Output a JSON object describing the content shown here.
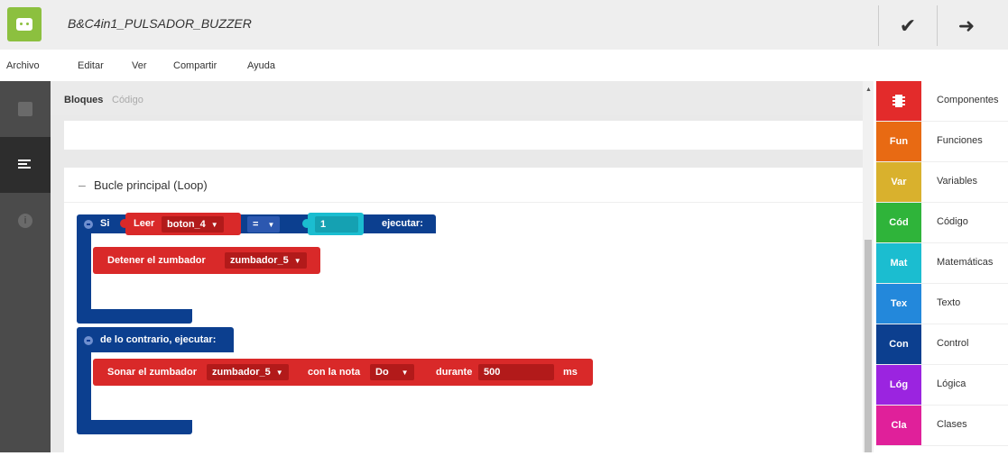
{
  "header": {
    "title": "B&C4in1_PULSADOR_BUZZER"
  },
  "menu": [
    "Archivo",
    "Editar",
    "Ver",
    "Compartir",
    "Ayuda"
  ],
  "tabs": {
    "bloques": "Bloques",
    "codigo": "Código"
  },
  "loop": {
    "title": "Bucle principal (Loop)"
  },
  "blocks": {
    "si": "Si",
    "leer": "Leer",
    "boton": "boton_4",
    "op": "=",
    "value": "1",
    "ejecutar": "ejecutar:",
    "detener": "Detener el zumbador",
    "zumbador1": "zumbador_5",
    "else_label": "de lo contrario, ejecutar:",
    "sonar": "Sonar el zumbador",
    "zumbador2": "zumbador_5",
    "nota_label": "con la nota",
    "nota": "Do",
    "durante": "durante",
    "duration": "500",
    "ms": "ms"
  },
  "categories": [
    {
      "abbr": "",
      "label": "Componentes",
      "color": "#e32b2b"
    },
    {
      "abbr": "Fun",
      "label": "Funciones",
      "color": "#e86a13"
    },
    {
      "abbr": "Var",
      "label": "Variables",
      "color": "#d9b12d"
    },
    {
      "abbr": "Cód",
      "label": "Código",
      "color": "#2fb43a"
    },
    {
      "abbr": "Mat",
      "label": "Matemáticas",
      "color": "#1bbdd0"
    },
    {
      "abbr": "Tex",
      "label": "Texto",
      "color": "#2388db"
    },
    {
      "abbr": "Con",
      "label": "Control",
      "color": "#0c3f8f"
    },
    {
      "abbr": "Lóg",
      "label": "Lógica",
      "color": "#9b24e0"
    },
    {
      "abbr": "Cla",
      "label": "Clases",
      "color": "#e0209a"
    }
  ]
}
